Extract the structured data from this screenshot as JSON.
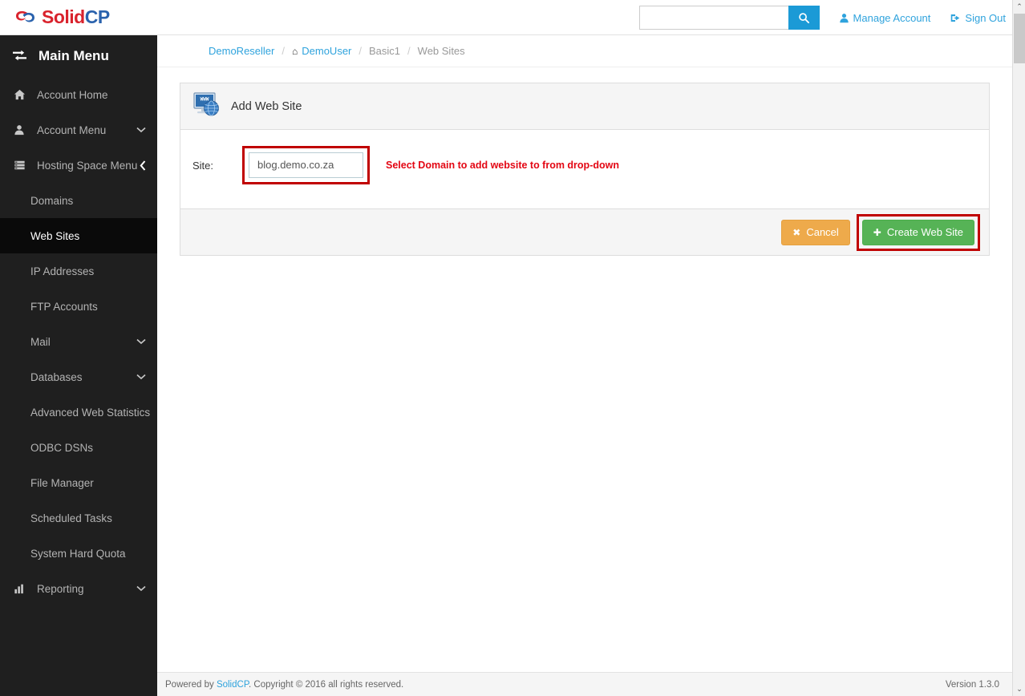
{
  "header": {
    "logo_text_primary": "Solid",
    "logo_text_secondary": "CP",
    "logo_icon": "solidcp-cloud-logo",
    "search": {
      "value": "",
      "placeholder": "",
      "button_icon": "search-icon"
    },
    "links": [
      {
        "label": "Manage Account",
        "icon": "user-icon"
      },
      {
        "label": "Sign Out",
        "icon": "sign-out-icon"
      }
    ]
  },
  "sidebar": {
    "title": "Main Menu",
    "title_icon": "exchange-arrows-icon",
    "items": [
      {
        "label": "Account Home",
        "icon": "home-icon",
        "sub": false,
        "chevron": "",
        "active": false
      },
      {
        "label": "Account Menu",
        "icon": "user-icon",
        "sub": false,
        "chevron": "down",
        "active": false
      },
      {
        "label": "Hosting Space Menu",
        "icon": "server-icon",
        "sub": false,
        "chevron": "left",
        "active": false
      },
      {
        "label": "Domains",
        "icon": "",
        "sub": true,
        "chevron": "",
        "active": false
      },
      {
        "label": "Web Sites",
        "icon": "",
        "sub": true,
        "chevron": "",
        "active": true
      },
      {
        "label": "IP Addresses",
        "icon": "",
        "sub": true,
        "chevron": "",
        "active": false
      },
      {
        "label": "FTP Accounts",
        "icon": "",
        "sub": true,
        "chevron": "",
        "active": false
      },
      {
        "label": "Mail",
        "icon": "",
        "sub": true,
        "chevron": "down",
        "active": false
      },
      {
        "label": "Databases",
        "icon": "",
        "sub": true,
        "chevron": "down",
        "active": false
      },
      {
        "label": "Advanced Web Statistics",
        "icon": "",
        "sub": true,
        "chevron": "",
        "active": false
      },
      {
        "label": "ODBC DSNs",
        "icon": "",
        "sub": true,
        "chevron": "",
        "active": false
      },
      {
        "label": "File Manager",
        "icon": "",
        "sub": true,
        "chevron": "",
        "active": false
      },
      {
        "label": "Scheduled Tasks",
        "icon": "",
        "sub": true,
        "chevron": "",
        "active": false
      },
      {
        "label": "System Hard Quota",
        "icon": "",
        "sub": true,
        "chevron": "",
        "active": false
      },
      {
        "label": "Reporting",
        "icon": "chart-bar-icon",
        "sub": false,
        "chevron": "down",
        "active": false
      }
    ]
  },
  "breadcrumb": {
    "items": [
      {
        "label": "DemoReseller",
        "link": true,
        "home_icon": false
      },
      {
        "label": "DemoUser",
        "link": true,
        "home_icon": true
      },
      {
        "label": "Basic1",
        "link": false,
        "home_icon": false
      },
      {
        "label": "Web Sites",
        "link": false,
        "home_icon": false
      }
    ],
    "separator": "/"
  },
  "panel": {
    "title": "Add Web Site",
    "title_icon": "website-monitor-globe-icon",
    "form": {
      "site_label": "Site:",
      "site_value": "blog.demo.co.za",
      "note": "Select Domain to add website to from drop-down"
    },
    "buttons": {
      "cancel_label": "Cancel",
      "cancel_glyph": "✖",
      "cancel_icon": "close-icon",
      "create_label": "Create Web Site",
      "create_glyph": "✚",
      "create_icon": "plus-icon"
    }
  },
  "footer": {
    "prefix": "Powered by ",
    "link_label": "SolidCP",
    "suffix": ". Copyright © 2016 all rights reserved.",
    "version": "Version 1.3.0"
  },
  "colors": {
    "brand_blue": "#2fa3dd",
    "search_blue": "#1b9ad6",
    "logo_red": "#d9232d",
    "logo_blue": "#2a62ad",
    "sidebar_bg": "#1f1f1f",
    "sidebar_active": "#0a0a0a",
    "highlight_red": "#c00000",
    "note_red": "#e30613",
    "cancel_orange": "#eeaa4b",
    "create_green": "#56b356"
  },
  "scrollbar": {
    "up_glyph": "⌃",
    "down_glyph": "⌄"
  }
}
